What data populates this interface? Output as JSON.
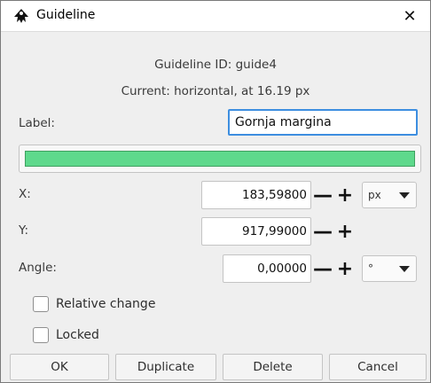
{
  "window": {
    "title": "Guideline",
    "close_glyph": "✕"
  },
  "info": {
    "guideline_id": "Guideline ID: guide4",
    "current": "Current: horizontal, at 16.19 px"
  },
  "label_field": {
    "label": "Label:",
    "value": "Gornja margina"
  },
  "color": {
    "swatch": "#5ed98c"
  },
  "x_field": {
    "label": "X:",
    "value": "183,59800",
    "minus": "—",
    "plus": "+"
  },
  "y_field": {
    "label": "Y:",
    "value": "917,99000",
    "minus": "—",
    "plus": "+"
  },
  "angle_field": {
    "label": "Angle:",
    "value": "0,00000",
    "minus": "—",
    "plus": "+"
  },
  "unit_select": {
    "selected": "px"
  },
  "angle_unit_select": {
    "selected": "°"
  },
  "checkboxes": {
    "relative_change": {
      "label": "Relative change",
      "checked": false
    },
    "locked": {
      "label": "Locked",
      "checked": false
    }
  },
  "buttons": {
    "ok": "OK",
    "duplicate": "Duplicate",
    "delete": "Delete",
    "cancel": "Cancel"
  },
  "icons": {
    "app": "inkscape-icon",
    "close": "close-icon",
    "dropdown": "chevron-down-icon"
  }
}
